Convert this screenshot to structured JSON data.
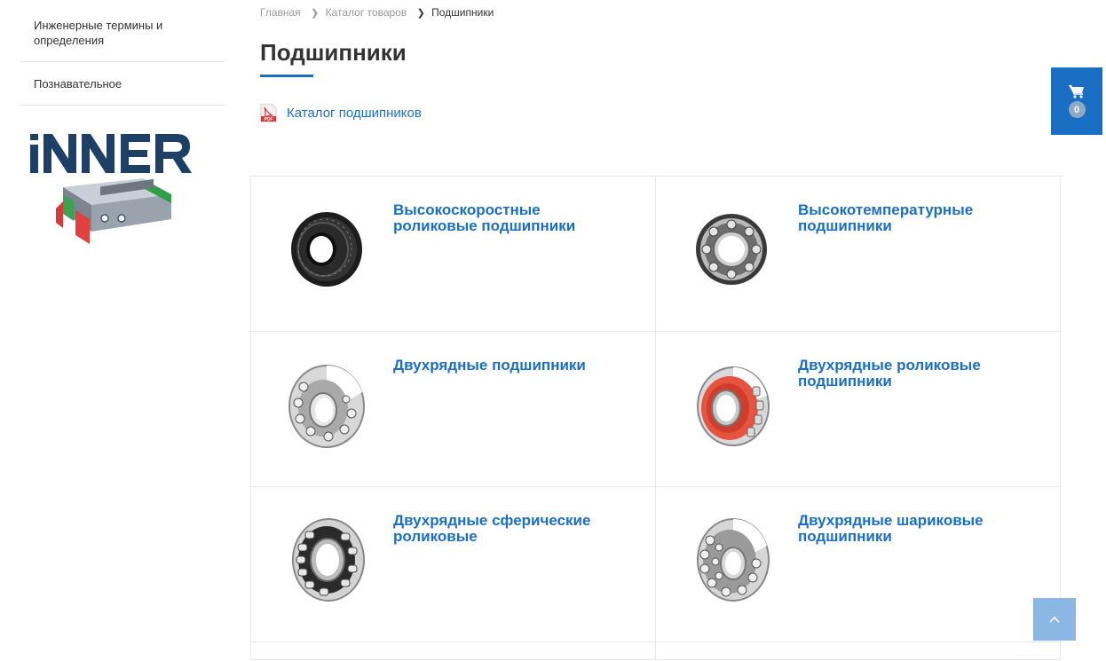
{
  "sidebar": {
    "items": [
      {
        "label": "Инженерные термины и определения"
      },
      {
        "label": "Познавательное"
      }
    ],
    "banner": {
      "brand": "iNNER"
    }
  },
  "breadcrumb": {
    "items": [
      "Главная",
      "Каталог товаров"
    ],
    "current": "Подшипники"
  },
  "page": {
    "title": "Подшипники",
    "pdf_icon_text": "PDF",
    "catalog_link": "Каталог подшипников"
  },
  "products": [
    {
      "name": "Высокоскоростные роликовые подшипники",
      "image": "black-roller-bearing"
    },
    {
      "name": "Высокотемпературные подшипники",
      "image": "ball-bearing"
    },
    {
      "name": "Двухрядные подшипники",
      "image": "double-row-bearing"
    },
    {
      "name": "Двухрядные роликовые подшипники",
      "image": "red-seal-roller-bearing"
    },
    {
      "name": "Двухрядные сферические роликовые",
      "image": "spherical-roller-bearing"
    },
    {
      "name": "Двухрядные шариковые подшипники",
      "image": "double-row-ball-bearing"
    }
  ],
  "cart": {
    "count": "0",
    "icon": "cart-icon"
  },
  "scroll_top": {
    "icon": "chevron-up-icon"
  },
  "colors": {
    "accent": "#1a6fc4",
    "cart_badge": "#8ea9c5",
    "scroll_top": "#8ab7e4"
  }
}
